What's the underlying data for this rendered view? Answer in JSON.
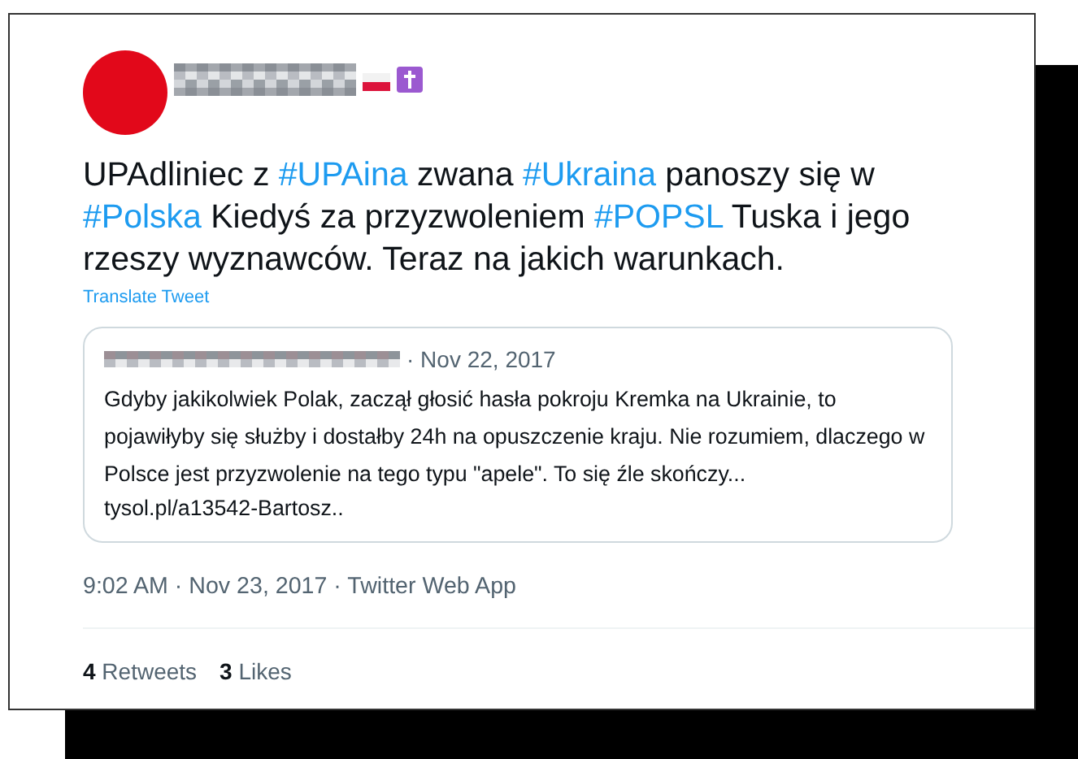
{
  "tweet": {
    "text": [
      {
        "kind": "plain",
        "text": "UPAdliniec z "
      },
      {
        "kind": "hashtag",
        "text": "#UPAina"
      },
      {
        "kind": "plain",
        "text": " zwana "
      },
      {
        "kind": "hashtag",
        "text": "#Ukraina"
      },
      {
        "kind": "plain",
        "text": " panoszy się w "
      },
      {
        "kind": "hashtag",
        "text": "#Polska"
      },
      {
        "kind": "plain",
        "text": " Kiedyś za przyzwoleniem "
      },
      {
        "kind": "hashtag",
        "text": "#POPSL"
      },
      {
        "kind": "plain",
        "text": " Tuska i jego rzeszy wyznawców. Teraz na jakich warunkach."
      }
    ],
    "translate": "Translate Tweet",
    "quote": {
      "date": "· Nov 22, 2017",
      "text": "Gdyby jakikolwiek Polak, zaczął głosić hasła pokroju Kremka na Ukrainie, to pojawiłyby się służby i dostałby 24h na opuszczenie kraju. Nie rozumiem, dlaczego w Polsce jest przyzwolenie na tego typu \"apele\". To się źle skończy...",
      "link": "tysol.pl/a13542-Bartosz.."
    },
    "timestamp": "9:02 AM · Nov 23, 2017 · Twitter Web App",
    "stats": [
      {
        "count": "4",
        "label": "Retweets"
      },
      {
        "count": "3",
        "label": "Likes"
      }
    ]
  }
}
